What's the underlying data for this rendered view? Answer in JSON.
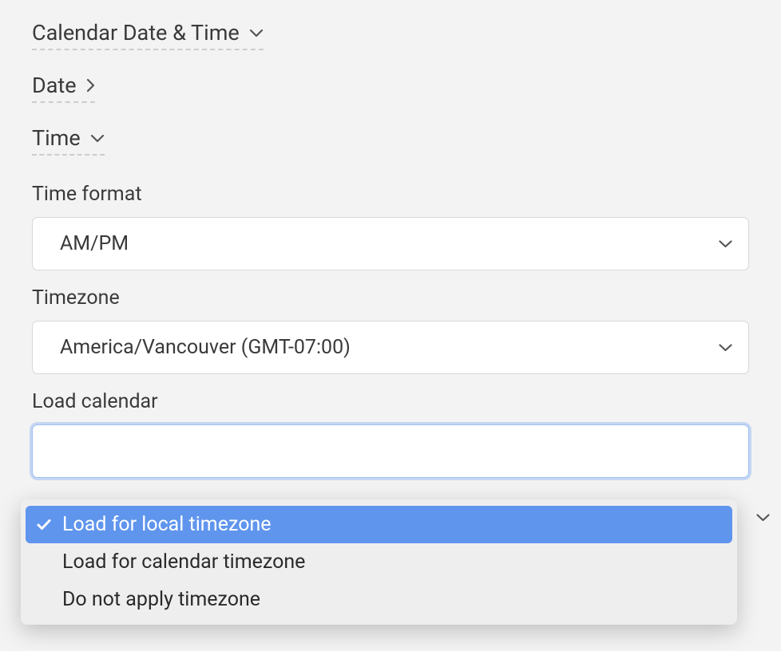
{
  "sections": {
    "calendar_datetime": {
      "title": "Calendar Date & Time"
    },
    "date": {
      "title": "Date"
    },
    "time": {
      "title": "Time"
    }
  },
  "fields": {
    "time_format": {
      "label": "Time format",
      "value": "AM/PM"
    },
    "timezone": {
      "label": "Timezone",
      "value": "America/Vancouver (GMT-07:00)"
    },
    "load_calendar": {
      "label": "Load calendar",
      "options": [
        "Load for local timezone",
        "Load for calendar timezone",
        "Do not apply timezone"
      ],
      "selected_index": 0
    }
  }
}
